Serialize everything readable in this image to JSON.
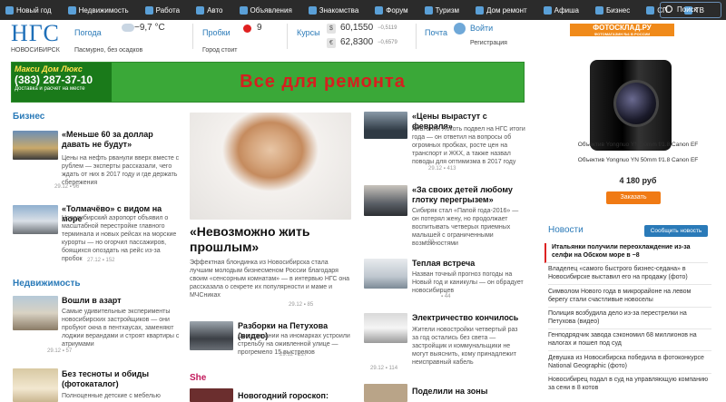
{
  "nav": [
    {
      "label": "Новый год",
      "icon": "tree-icon"
    },
    {
      "label": "Недвижимость",
      "icon": "home-icon"
    },
    {
      "label": "Работа",
      "icon": "briefcase-icon"
    },
    {
      "label": "Авто",
      "icon": "car-icon"
    },
    {
      "label": "Объявления",
      "icon": "document-icon"
    },
    {
      "label": "Знакомства",
      "icon": "heart-icon"
    },
    {
      "label": "Форум",
      "icon": "chat-icon"
    },
    {
      "label": "Туризм",
      "icon": "plane-icon"
    },
    {
      "label": "Дом ремонт",
      "icon": "hammer-icon"
    },
    {
      "label": "Афиша",
      "icon": "ticket-icon"
    },
    {
      "label": "Бизнес",
      "icon": "chart-icon"
    },
    {
      "label": "СП",
      "icon": "cart-icon"
    },
    {
      "label": "ТВ",
      "icon": "tv-icon"
    }
  ],
  "search": {
    "label": "Поиск"
  },
  "logo": {
    "big": "НГС",
    "small": "НОВОСИБИРСК"
  },
  "weather": {
    "title": "Погода",
    "temp": "−9,7 °C",
    "desc": "Пасмурно, без осадков"
  },
  "traffic": {
    "title": "Пробки",
    "score": "9",
    "desc": "Город стоит"
  },
  "rates": {
    "title": "Курсы",
    "usd": "60,1550",
    "usd_change": "−0,5119",
    "eur": "62,8300",
    "eur_change": "−0,6579",
    "usd_symbol": "$",
    "eur_symbol": "€"
  },
  "mail": {
    "title": "Почта",
    "login": "Войти",
    "register": "Регистрация"
  },
  "banner": {
    "brand": "Макси Дом Люкс",
    "phone": "(383) 287-37-10",
    "sub": "Доставка и расчет на месте",
    "headline": "Все для ремонта"
  },
  "sections": {
    "business": "Бизнес",
    "realty": "Недвижимость",
    "she": "She"
  },
  "left_articles": [
    {
      "title": "«Меньше 60 за доллар давать не будут»",
      "text": "Цены на нефть рванули вверх вместе с рублем — эксперты рассказали, чего ждать от них в 2017 году и где держать сбережения",
      "date": "29.12",
      "count": "96"
    },
    {
      "title": "«Толмачёво» с видом на море",
      "text": "Новосибирский аэропорт объявил о масштабной перестройке главного терминала и новых рейсах на морские курорты — но огорчил пассажиров, боящихся опоздать на рейс из-за пробок",
      "date": "27.12",
      "count": "152"
    },
    {
      "title": "Вошли в азарт",
      "text": "Самые удивительные эксперименты новосибирских застройщиков — они пробуют окна в пентхаусах, заменяют лоджии верандами и строят квартиры с атриумами",
      "date": "29.12",
      "count": "57"
    },
    {
      "title": "Без тесноты и обиды (фотокаталог)",
      "text": "Полноценные детские с мебелью"
    }
  ],
  "center": {
    "title": "«Невозможно жить прошлым»",
    "text": "Эффектная блондинка из Новосибирска стала лучшим молодым бизнесменом России благодаря своим «сенсорным комнатам» — в интервью НГС она рассказала о секрете их популярности и маме и МЧСниках",
    "date": "29.12",
    "count": "85",
    "small_title": "Разборки на Петухова (видео)",
    "small_text": "Две компании на иномарках устроили стрельбу на оживленной улице — прогремело 15 выстрелов",
    "small_date": "29.12",
    "small_count": "227",
    "she_title": "Новогодний гороскоп: Петух"
  },
  "mid_articles": [
    {
      "title": "«Цены вырастут с февраля»",
      "text": "Анатолий Локоть подвел на НГС итоги года — он ответил на вопросы об огромных пробках, росте цен на транспорт и ЖКХ, а также назвал поводы для оптимизма в 2017 году",
      "date": "29.12",
      "count": "413"
    },
    {
      "title": "«За своих детей любому глотку перегрызем»",
      "text": "Сибиряк стал «Папой года-2016» — он потерял жену, но продолжает воспитывать четверых приемных малышей с ограниченными возможностями",
      "count": "99"
    },
    {
      "title": "Теплая встреча",
      "text": "Назван точный прогноз погоды на Новый год и каникулы — он обрадует новосибирцев",
      "count": "44"
    },
    {
      "title": "Электричество кончилось",
      "text": "Жители новостройки четвертый раз за год остались без света — застройщик и коммунальщики не могут выяснить, кому принадлежит неисправный кабель",
      "date": "29.12",
      "count": "114"
    },
    {
      "title": "Поделили на зоны"
    }
  ],
  "ad": {
    "logo": "ФОТОСКЛАД.РУ",
    "logo_sub": "ФОТОМАГАЗИН №1 В РОССИИ",
    "product": "Объектив Yongnuo YN 50mm f/1.8 Canon EF",
    "product2": "Объектив Yongnuo YN 50mm f/1.8 Canon EF",
    "price": "4 180 руб",
    "button": "Заказать"
  },
  "news": {
    "title": "Новости",
    "send": "Сообщить новость",
    "items": [
      "Итальянки получили переохлаждение из-за селфи на Обском море в −8",
      "Владелец «самого быстрого бизнес-седана» в Новосибирске выставил его на продажу (фото)",
      "Символом Нового года в микрорайоне на левом берегу стали счастливые новоселы",
      "Полиция возбудила дело из-за перестрелки на Петухова (видео)",
      "Генподрядчик завода сэкономил 68 миллионов на налогах и пошел под суд",
      "Девушка из Новосибирска победила в фотоконкурсе National Geographic (фото)",
      "Новосибирец подал в суд на управляющую компанию за сени в 8 котов"
    ]
  }
}
